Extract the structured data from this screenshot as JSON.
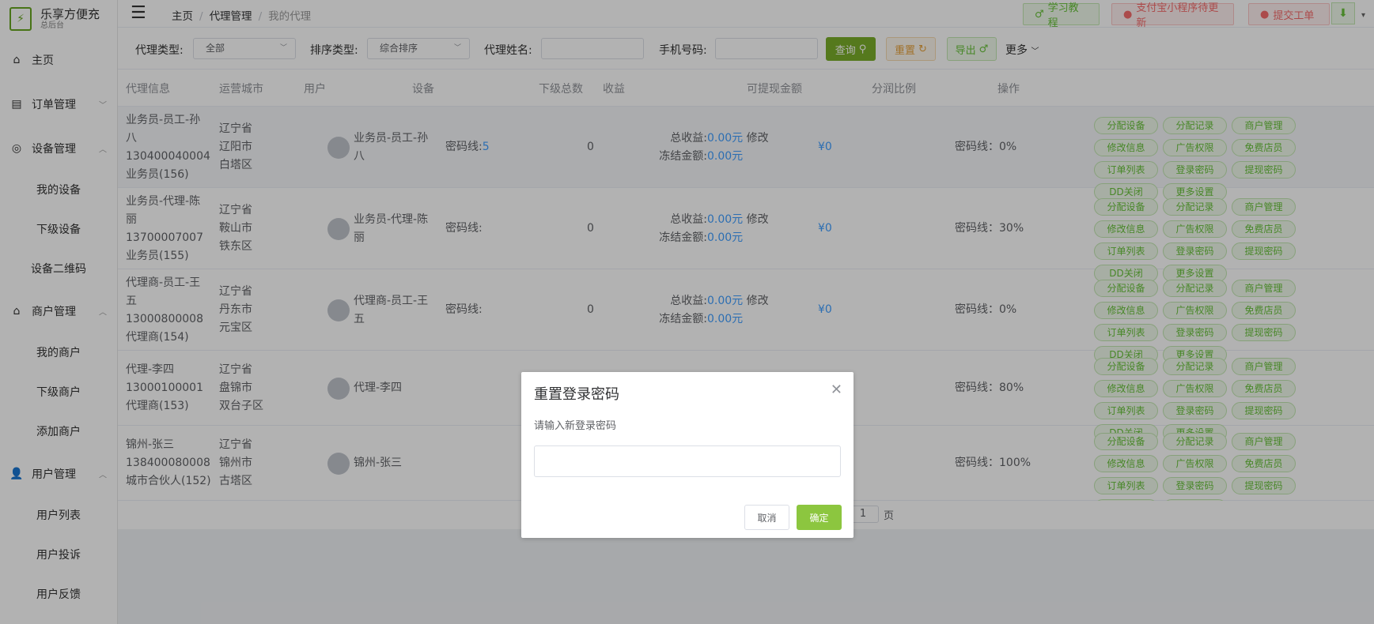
{
  "brand": {
    "title": "乐享方便充",
    "subtitle": "总后台"
  },
  "sidebar": {
    "items": [
      {
        "type": "group",
        "label": "主页",
        "icon": "home-icon"
      },
      {
        "type": "group",
        "label": "订单管理",
        "icon": "order-icon",
        "arrow": "down"
      },
      {
        "type": "group",
        "label": "设备管理",
        "icon": "device-icon",
        "arrow": "up"
      },
      {
        "type": "sub",
        "label": "我的设备"
      },
      {
        "type": "sub",
        "label": "下级设备"
      },
      {
        "type": "sub",
        "label": "设备二维码"
      },
      {
        "type": "group",
        "label": "商户管理",
        "icon": "store-icon",
        "arrow": "up"
      },
      {
        "type": "sub",
        "label": "我的商户"
      },
      {
        "type": "sub",
        "label": "下级商户"
      },
      {
        "type": "sub",
        "label": "添加商户"
      },
      {
        "type": "group",
        "label": "用户管理",
        "icon": "user-icon",
        "arrow": "up"
      },
      {
        "type": "sub",
        "label": "用户列表"
      },
      {
        "type": "sub",
        "label": "用户投诉"
      },
      {
        "type": "sub",
        "label": "用户反馈"
      }
    ]
  },
  "breadcrumb": [
    "主页",
    "代理管理",
    "我的代理"
  ],
  "toolbar": {
    "tutorial": "学习教程",
    "alipay_update": "支付宝小程序待更新",
    "ticket": "提交工单"
  },
  "filters": {
    "type_label": "代理类型:",
    "type_value": "全部",
    "sort_label": "排序类型:",
    "sort_value": "综合排序",
    "name_label": "代理姓名:",
    "phone_label": "手机号码:",
    "query": "查询",
    "reset": "重置",
    "export": "导出",
    "more": "更多"
  },
  "table": {
    "headers": [
      "代理信息",
      "运营城市",
      "用户",
      "设备",
      "下级总数",
      "收益",
      "可提现金额",
      "分润比例",
      "操作"
    ],
    "labels": {
      "device_prefix": "密码线:",
      "total_income": "总收益:",
      "frozen": "冻结金额:",
      "modify": "修改"
    },
    "rows": [
      {
        "info": [
          "业务员-员工-孙",
          "八",
          "130400040004",
          "业务员(156)"
        ],
        "city": [
          "辽宁省",
          "辽阳市",
          "白塔区"
        ],
        "user": [
          "业务员-员工-孙",
          "八"
        ],
        "device": "5",
        "sub": "0",
        "income": "0.00元",
        "frozen": "0.00元",
        "withdraw": "¥0",
        "share": "密码线：0%",
        "show_money": true
      },
      {
        "info": [
          "业务员-代理-陈",
          "丽",
          "13700007007",
          "业务员(155)"
        ],
        "city": [
          "辽宁省",
          "鞍山市",
          "铁东区"
        ],
        "user": [
          "业务员-代理-陈",
          "丽"
        ],
        "device": "",
        "sub": "0",
        "income": "0.00元",
        "frozen": "0.00元",
        "withdraw": "¥0",
        "share": "密码线：30%",
        "show_money": true
      },
      {
        "info": [
          "代理商-员工-王",
          "五",
          "13000800008",
          "代理商(154)"
        ],
        "city": [
          "辽宁省",
          "丹东市",
          "元宝区"
        ],
        "user": [
          "代理商-员工-王",
          "五"
        ],
        "device": "",
        "sub": "0",
        "income": "0.00元",
        "frozen": "0.00元",
        "withdraw": "¥0",
        "share": "密码线：0%",
        "show_money": true
      },
      {
        "info": [
          "代理-李四",
          "13000100001",
          "代理商(153)"
        ],
        "city": [
          "辽宁省",
          "盘锦市",
          "双台子区"
        ],
        "user": [
          "代理-李四"
        ],
        "device": "",
        "sub": "",
        "income": "",
        "frozen": "",
        "withdraw": "",
        "share": "密码线：80%",
        "show_money": false
      },
      {
        "info": [
          "锦州-张三",
          "138400080008",
          "城市合伙人(152)"
        ],
        "city": [
          "辽宁省",
          "锦州市",
          "古塔区"
        ],
        "user": [
          "锦州-张三"
        ],
        "device": "",
        "sub": "",
        "income": "",
        "frozen": "",
        "withdraw": "",
        "share": "密码线：100%",
        "show_money": false
      }
    ],
    "ops": [
      "分配设备",
      "分配记录",
      "商户管理",
      "修改信息",
      "广告权限",
      "免费店员",
      "订单列表",
      "登录密码",
      "提现密码",
      "DD关闭",
      "更多设置"
    ]
  },
  "pager": {
    "page": "1",
    "suffix": "页"
  },
  "dialog": {
    "title": "重置登录密码",
    "label": "请输入新登录密码",
    "value": "",
    "cancel": "取消",
    "confirm": "确定"
  }
}
